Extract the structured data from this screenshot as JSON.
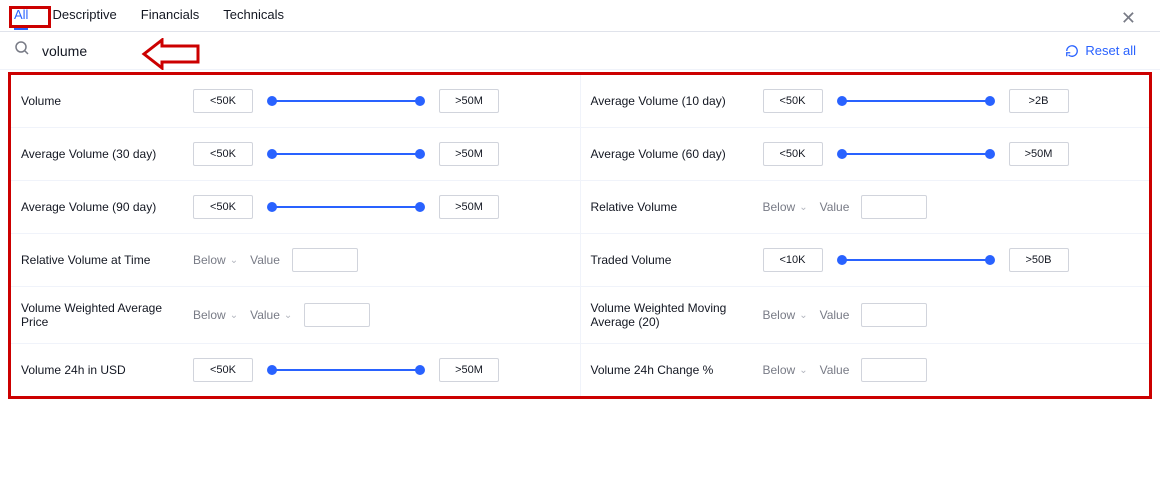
{
  "tabs": {
    "all": "All",
    "descriptive": "Descriptive",
    "financials": "Financials",
    "technicals": "Technicals"
  },
  "search": {
    "value": "volume"
  },
  "reset": "Reset all",
  "filters": {
    "volume": {
      "label": "Volume",
      "min": "<50K",
      "max": ">50M"
    },
    "avg10": {
      "label": "Average Volume (10 day)",
      "min": "<50K",
      "max": ">2B"
    },
    "avg30": {
      "label": "Average Volume (30 day)",
      "min": "<50K",
      "max": ">50M"
    },
    "avg60": {
      "label": "Average Volume (60 day)",
      "min": "<50K",
      "max": ">50M"
    },
    "avg90": {
      "label": "Average Volume (90 day)",
      "min": "<50K",
      "max": ">50M"
    },
    "relvol": {
      "label": "Relative Volume",
      "below": "Below",
      "value": "Value"
    },
    "relvolt": {
      "label": "Relative Volume at Time",
      "below": "Below",
      "value": "Value"
    },
    "traded": {
      "label": "Traded Volume",
      "min": "<10K",
      "max": ">50B"
    },
    "vwap": {
      "label": "Volume Weighted Average Price",
      "below": "Below",
      "value": "Value"
    },
    "vwma": {
      "label": "Volume Weighted Moving Average (20)",
      "below": "Below",
      "value": "Value"
    },
    "v24": {
      "label": "Volume 24h in USD",
      "min": "<50K",
      "max": ">50M"
    },
    "v24c": {
      "label": "Volume 24h Change %",
      "below": "Below",
      "value": "Value"
    }
  }
}
